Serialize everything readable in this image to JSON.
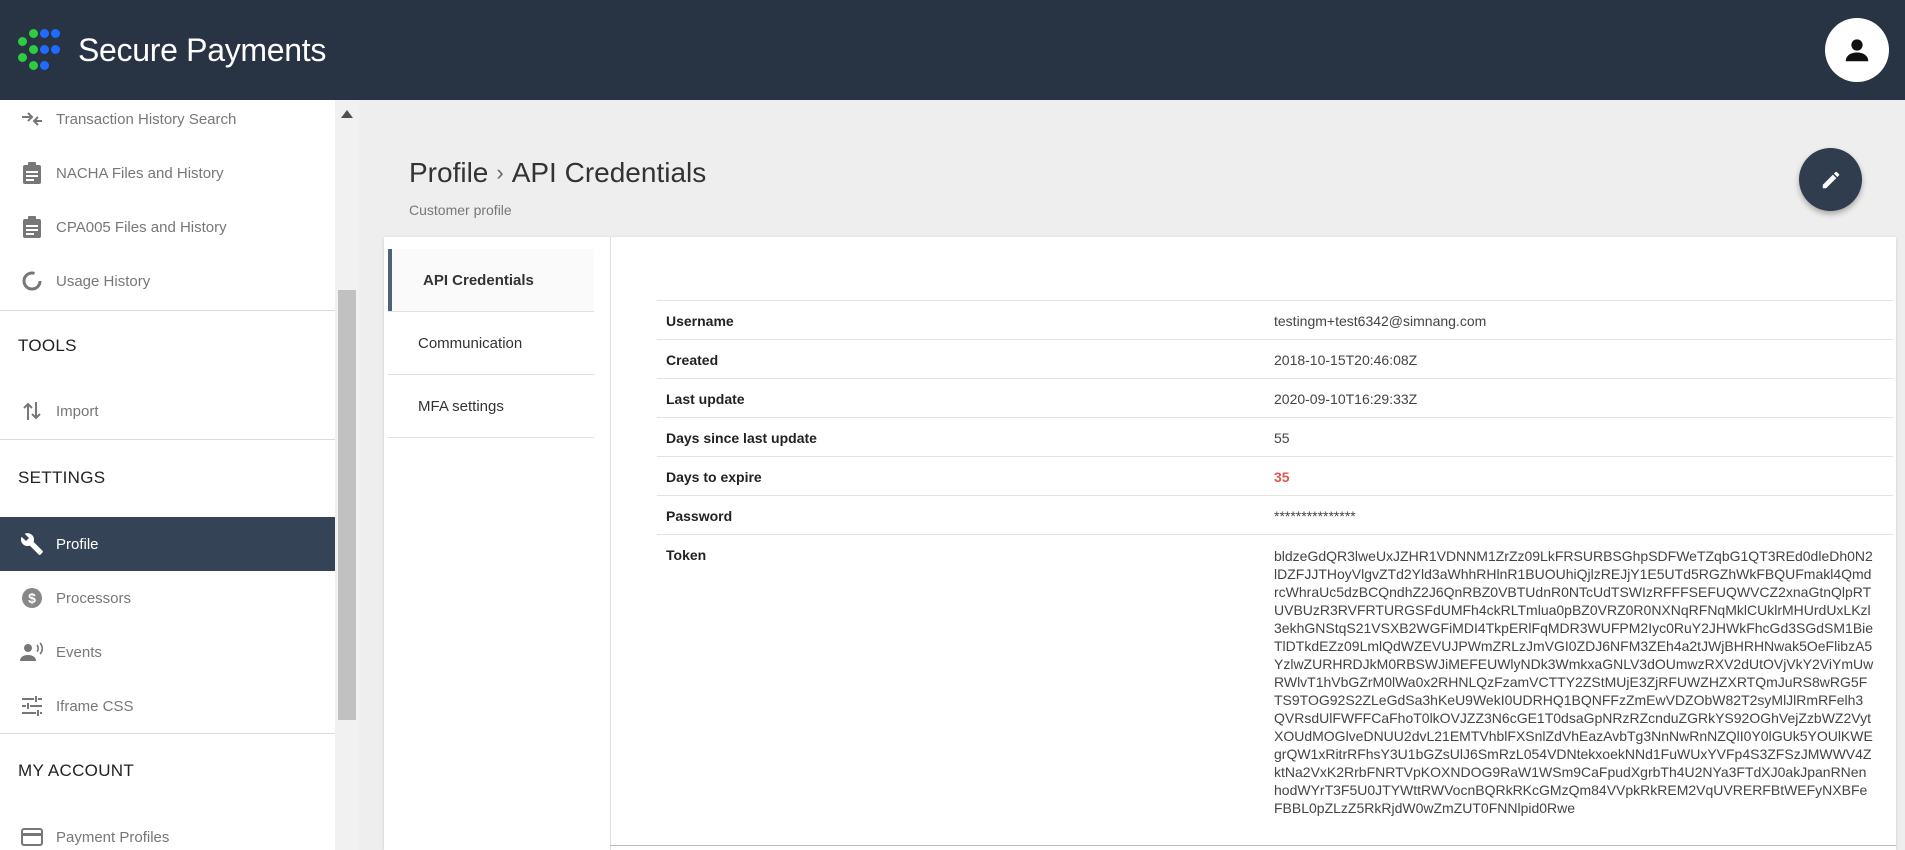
{
  "header": {
    "brand": "Secure Payments",
    "brand_colors": [
      "#2ecc40",
      "#1f6bff"
    ],
    "avatar_icon": "account-icon"
  },
  "sidebar": {
    "items": [
      {
        "label": "Transaction History Search",
        "icon": "transfer-arrows-icon"
      },
      {
        "label": "NACHA Files and History",
        "icon": "clipboard-icon"
      },
      {
        "label": "CPA005 Files and History",
        "icon": "clipboard-icon"
      },
      {
        "label": "Usage History",
        "icon": "donut-chart-icon"
      }
    ],
    "tools_title": "TOOLS",
    "tools_items": [
      {
        "label": "Import",
        "icon": "import-arrows-icon"
      }
    ],
    "settings_title": "SETTINGS",
    "settings_items": [
      {
        "label": "Profile",
        "icon": "wrench-icon",
        "active": true
      },
      {
        "label": "Processors",
        "icon": "dollar-icon"
      },
      {
        "label": "Events",
        "icon": "person-voice-icon"
      },
      {
        "label": "Iframe CSS",
        "icon": "tune-icon"
      }
    ],
    "account_title": "MY ACCOUNT",
    "account_items": [
      {
        "label": "Payment Profiles",
        "icon": "credit-card-icon"
      }
    ]
  },
  "main": {
    "breadcrumb_root": "Profile",
    "breadcrumb_sep": "›",
    "breadcrumb_current": "API Credentials",
    "subtitle": "Customer profile",
    "edit_icon": "pencil-icon",
    "tabs": [
      {
        "label": "API Credentials",
        "active": true
      },
      {
        "label": "Communication"
      },
      {
        "label": "MFA settings"
      }
    ],
    "details": {
      "username_label": "Username",
      "username": "testingm+test6342@simnang.com",
      "created_label": "Created",
      "created": "2018-10-15T20:46:08Z",
      "last_update_label": "Last update",
      "last_update": "2020-09-10T16:29:33Z",
      "days_since_label": "Days since last update",
      "days_since": "55",
      "days_expire_label": "Days to expire",
      "days_expire": "35",
      "password_label": "Password",
      "password": "***************",
      "token_label": "Token",
      "token": "bldzeGdQR3lweUxJZHR1VDNNM1ZrZz09LkFRSURBSGhpSDFWeTZqbG1QT3REd0dleDh0N2lDZFJJTHoyVlgvZTd2Yld3aWhhRHlnR1BUOUhiQjlzREJjY1E5UTd5RGZhWkFBQUFmakl4QmdrcWhraUc5dzBCQndhZ2J6QnRBZ0VBTUdnR0NTcUdTSWIzRFFFSEFUQWVCZ2xnaGtnQlpRTUVBUzR3RVFRTURGSFdUMFh4ckRLTmlua0pBZ0VRZ0R0NXNqRFNqMklCUklrMHUrdUxLKzl3ekhGNStqS21VSXB2WGFiMDI4TkpERlFqMDR3WUFPM2Iyc0RuY2JHWkFhcGd3SGdSM1BieTlDTkdEZz09LmlQdWZEVUJPWmZRLzJmVGI0ZDJ6NFM3ZEh4a2tJWjBHRHNwak5OeFlibzA5YzlwZURHRDJkM0RBSWJiMEFEUWlyNDk3WmkxaGNLV3dOUmwzRXV2dUtOVjVkY2ViYmUwRWlvT1hVbGZrM0lWa0x2RHNLQzFzamVCTTY2ZStMUjE3ZjRFUWZHZXRTQmJuRS8wRG5FTS9TOG92S2ZLeGdSa3hKeU9WekI0UDRHQ1BQNFFzZmEwVDZObW82T2syMlJlRmRFelh3QVRsdUlFWFFCaFhoT0lkOVJZZ3N6cGE1T0dsaGpNRzRZcnduZGRkYS92OGhVejZzbWZ2VytXOUdMOGlveDNUU2dvL21EMTVhblFXSnlZdVhEazAvbTg3NnNwRnNZQlI0Y0lGUk5YOUlKWEgrQW1xRitrRFhsY3U1bGZsUlJ6SmRzL054VDNtekxoekNNd1FuWUxYVFp4S3ZFSzJMWWV4ZktNa2VxK2RrbFNRTVpKOXNDOG9RaW1WSm9CaFpudXgrbTh4U2NYa3FTdXJ0akJpanRNenhodWYrT3F5U0JTYWttRWVocnBQRkRKcGMzQm84VVpkRkREM2VqUVRERFBtWEFyNXBFeFBBL0pZLzZ5RkRjdW0wZmZUT0FNNlpid0Rwe"
    }
  }
}
